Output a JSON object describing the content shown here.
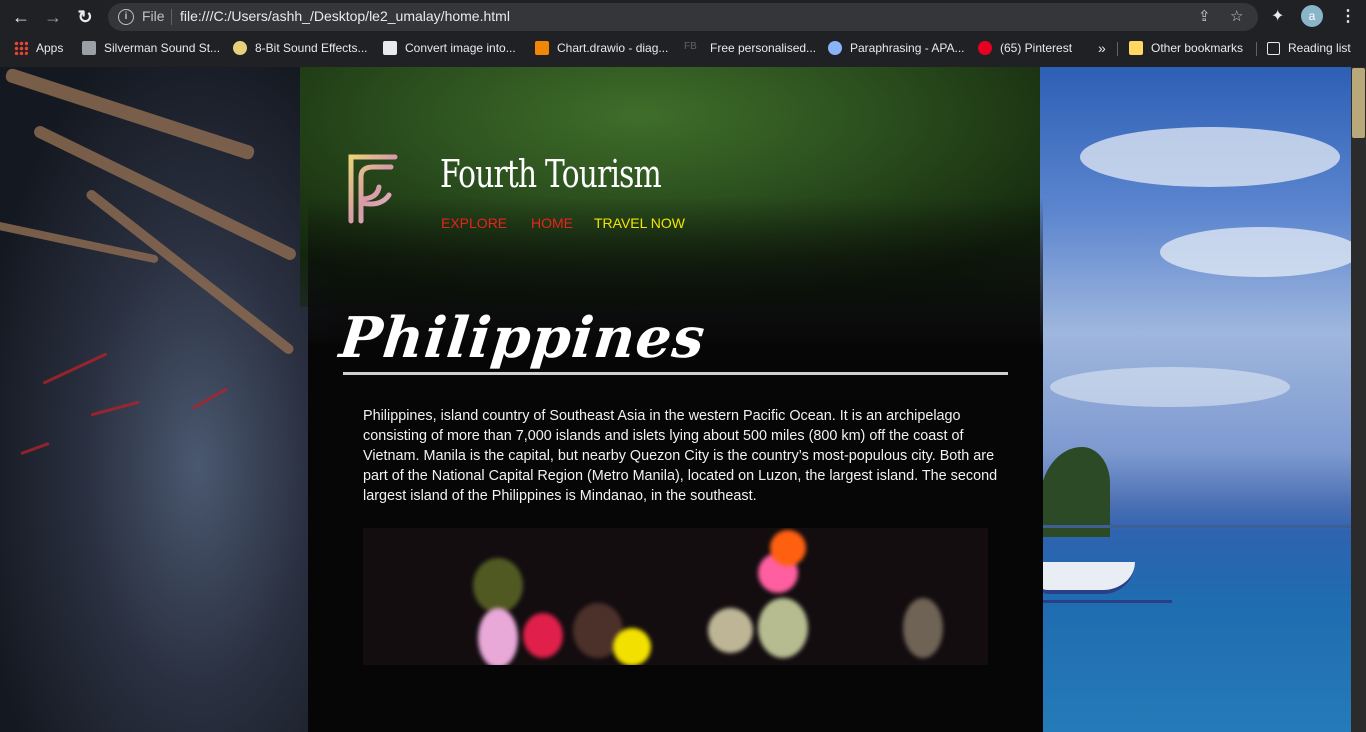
{
  "browser": {
    "nav": {
      "back": "←",
      "forward": "→",
      "reload": "↻"
    },
    "omnibox": {
      "info_glyph": "i",
      "scheme_label": "File",
      "url": "file:///C:/Users/ashh_/Desktop/le2_umalay/home.html"
    },
    "profile_initial": "a"
  },
  "bookmarks": {
    "items": [
      {
        "label": "Apps",
        "icon": "apps-grid-icon",
        "color": "#e8453c"
      },
      {
        "label": "Silverman Sound St...",
        "icon": "site-icon",
        "color": "#9aa0a6"
      },
      {
        "label": "8-Bit Sound Effects...",
        "icon": "site-icon",
        "color": "#e6d17a"
      },
      {
        "label": "Convert image into...",
        "icon": "site-icon",
        "color": "#e8eaed"
      },
      {
        "label": "Chart.drawio - diag...",
        "icon": "drawio-icon",
        "color": "#f08705"
      },
      {
        "label": "Free personalised...",
        "icon": "fb-text-icon",
        "color": "#5f6368"
      },
      {
        "label": "Paraphrasing - APA...",
        "icon": "cloud-icon",
        "color": "#8ab4f8"
      },
      {
        "label": "(65) Pinterest",
        "icon": "pinterest-icon",
        "color": "#e60023"
      }
    ],
    "overflow": "»",
    "other_bookmarks": "Other bookmarks",
    "reading_list": "Reading list"
  },
  "site": {
    "title": "Fourth Tourism",
    "nav": [
      {
        "label": "EXPLORE",
        "color": "#e8231c"
      },
      {
        "label": "HOME",
        "color": "#e8231c"
      },
      {
        "label": "TRAVEL NOW",
        "color": "#f2e600"
      }
    ],
    "heading": "Philippines",
    "description": "Philippines, island country of Southeast Asia in the western Pacific Ocean. It is an archipelago consisting of more than 7,000 islands and islets lying about 500 miles (800 km) off the coast of Vietnam. Manila is the capital, but nearby Quezon City is the country’s most-populous city. Both are part of the National Capital Region (Metro Manila), located on Luzon, the largest island. The second largest island of the Philippines is Mindanao, in the southeast."
  },
  "colors": {
    "chrome_bg": "#202124",
    "nav_red": "#e8231c",
    "nav_yellow": "#f2e600",
    "panel_bg": "#060606"
  }
}
